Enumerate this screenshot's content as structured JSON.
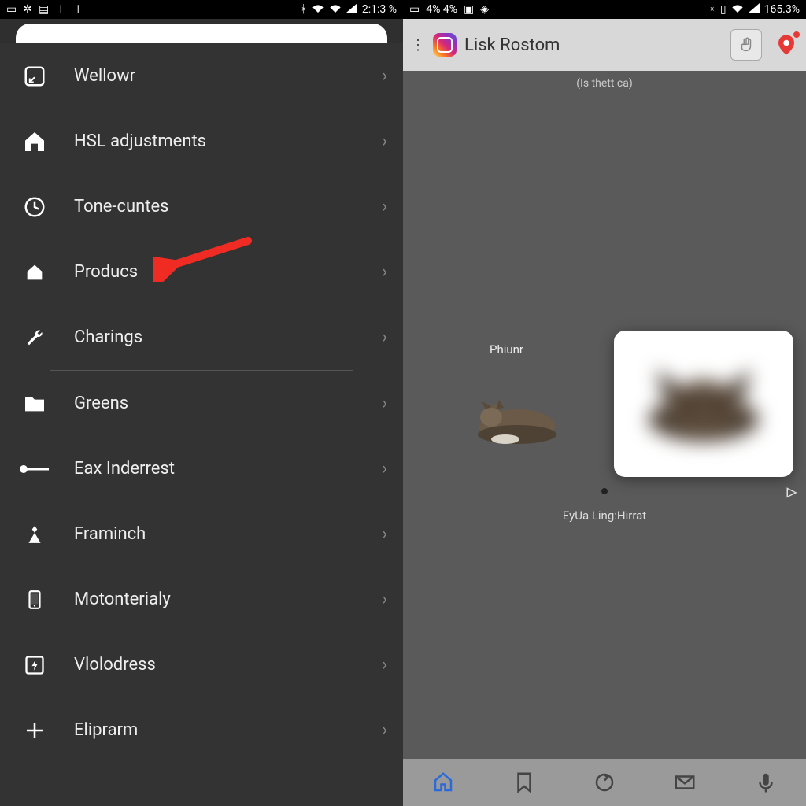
{
  "left": {
    "status": {
      "battery_text": "2:1:3 %"
    },
    "menu": [
      {
        "label": "Wellowr"
      },
      {
        "label": "HSL adjustments"
      },
      {
        "label": "Tone-cuntes"
      },
      {
        "label": "Producs"
      },
      {
        "label": "Charings"
      }
    ],
    "menu2": [
      {
        "label": "Greens"
      },
      {
        "label": "Eax Inderrest"
      },
      {
        "label": "Framinch"
      },
      {
        "label": "Motonterialy"
      },
      {
        "label": "Vlolodress"
      },
      {
        "label": "Eliprarm"
      }
    ]
  },
  "right": {
    "status": {
      "net_text": "4% 4%",
      "battery_text": "165.3%"
    },
    "header": {
      "title": "Lisk Rostom"
    },
    "subtitle": "(Is thett ca)",
    "label_small": "Phiunr",
    "caption": "EyUa Ling:Hirrat"
  }
}
